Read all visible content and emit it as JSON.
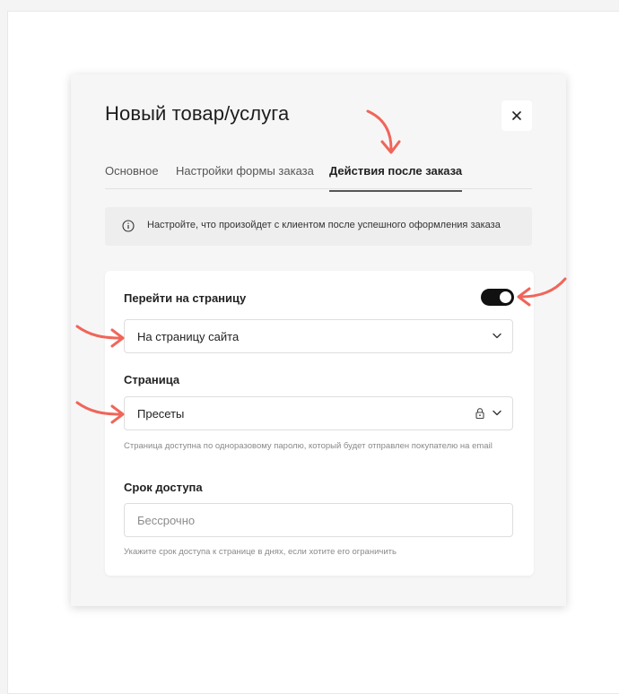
{
  "modal": {
    "title": "Новый товар/услуга",
    "close_icon": "close-icon"
  },
  "tabs": [
    {
      "label": "Основное",
      "active": false
    },
    {
      "label": "Настройки формы заказа",
      "active": false
    },
    {
      "label": "Действия после заказа",
      "active": true
    }
  ],
  "info": {
    "icon": "info-icon",
    "text": "Настройте, что произойдет с клиентом после успешного оформления заказа"
  },
  "redirect": {
    "label": "Перейти на страницу",
    "toggle_on": true,
    "target_value": "На страницу сайта"
  },
  "page": {
    "label": "Страница",
    "value": "Пресеты",
    "lock_icon": "lock-icon",
    "hint": "Страница доступна по одноразовому паролю, который будет отправлен покупателю на email"
  },
  "access": {
    "label": "Срок доступа",
    "placeholder": "Бессрочно",
    "hint": "Укажите срок доступа к странице в днях, если хотите его ограничить"
  },
  "colors": {
    "annotation_arrow": "#f0655a",
    "toggle_on": "#111111",
    "modal_bg": "#f6f6f6",
    "card_bg": "#ffffff"
  }
}
